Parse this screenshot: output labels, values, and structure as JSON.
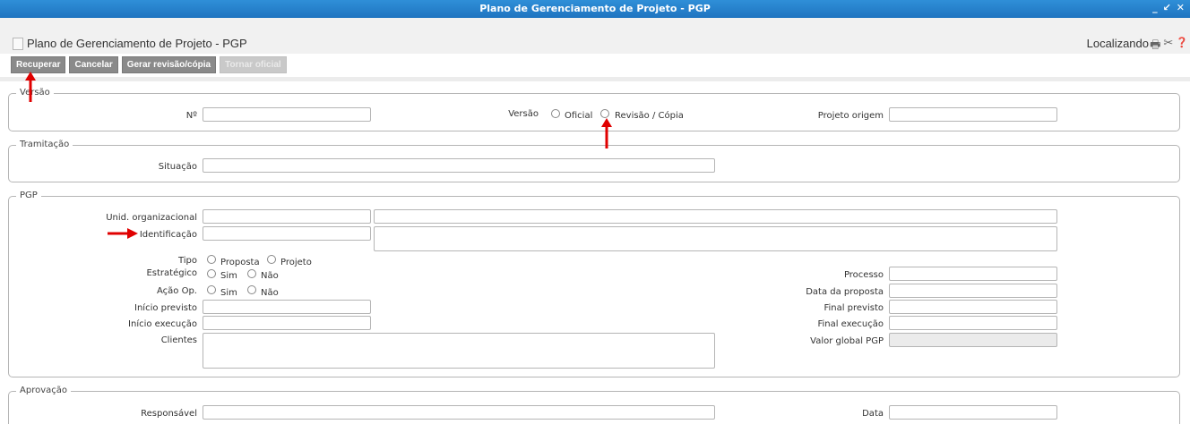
{
  "window": {
    "title": "Plano de Gerenciamento de Projeto - PGP",
    "controls": [
      "_",
      "↙",
      "✕"
    ]
  },
  "header": {
    "page_title": "Plano de Gerenciamento de Projeto - PGP",
    "status": "Localizando",
    "icons": [
      "print-icon",
      "tools-icon",
      "help-icon"
    ]
  },
  "toolbar": {
    "recuperar": "Recuperar",
    "cancelar": "Cancelar",
    "gerar": "Gerar revisão/cópia",
    "tornar": "Tornar oficial"
  },
  "versao": {
    "legend": "Versão",
    "numero_label": "Nº",
    "numero_value": "",
    "versao_label": "Versão",
    "opt_oficial": "Oficial",
    "opt_revisao": "Revisão / Cópia",
    "projeto_origem_label": "Projeto origem",
    "projeto_origem_value": ""
  },
  "tramitacao": {
    "legend": "Tramitação",
    "situacao_label": "Situação",
    "situacao_value": ""
  },
  "pgp": {
    "legend": "PGP",
    "unid_label": "Unid. organizacional",
    "identificacao_label": "Identificação",
    "tipo_label": "Tipo",
    "tipo_opt1": "Proposta",
    "tipo_opt2": "Projeto",
    "estrategico_label": "Estratégico",
    "acao_label": "Ação Op.",
    "sim": "Sim",
    "nao": "Não",
    "inicio_previsto_label": "Início previsto",
    "inicio_execucao_label": "Início execução",
    "clientes_label": "Clientes",
    "processo_label": "Processo",
    "data_proposta_label": "Data da proposta",
    "final_previsto_label": "Final previsto",
    "final_execucao_label": "Final execução",
    "valor_global_label": "Valor global PGP"
  },
  "aprovacao": {
    "legend": "Aprovação",
    "responsavel_label": "Responsável",
    "data_label": "Data"
  },
  "colors": {
    "titlebar": "#1f74c0",
    "button": "#8a8a8a",
    "arrow": "#e00000"
  }
}
